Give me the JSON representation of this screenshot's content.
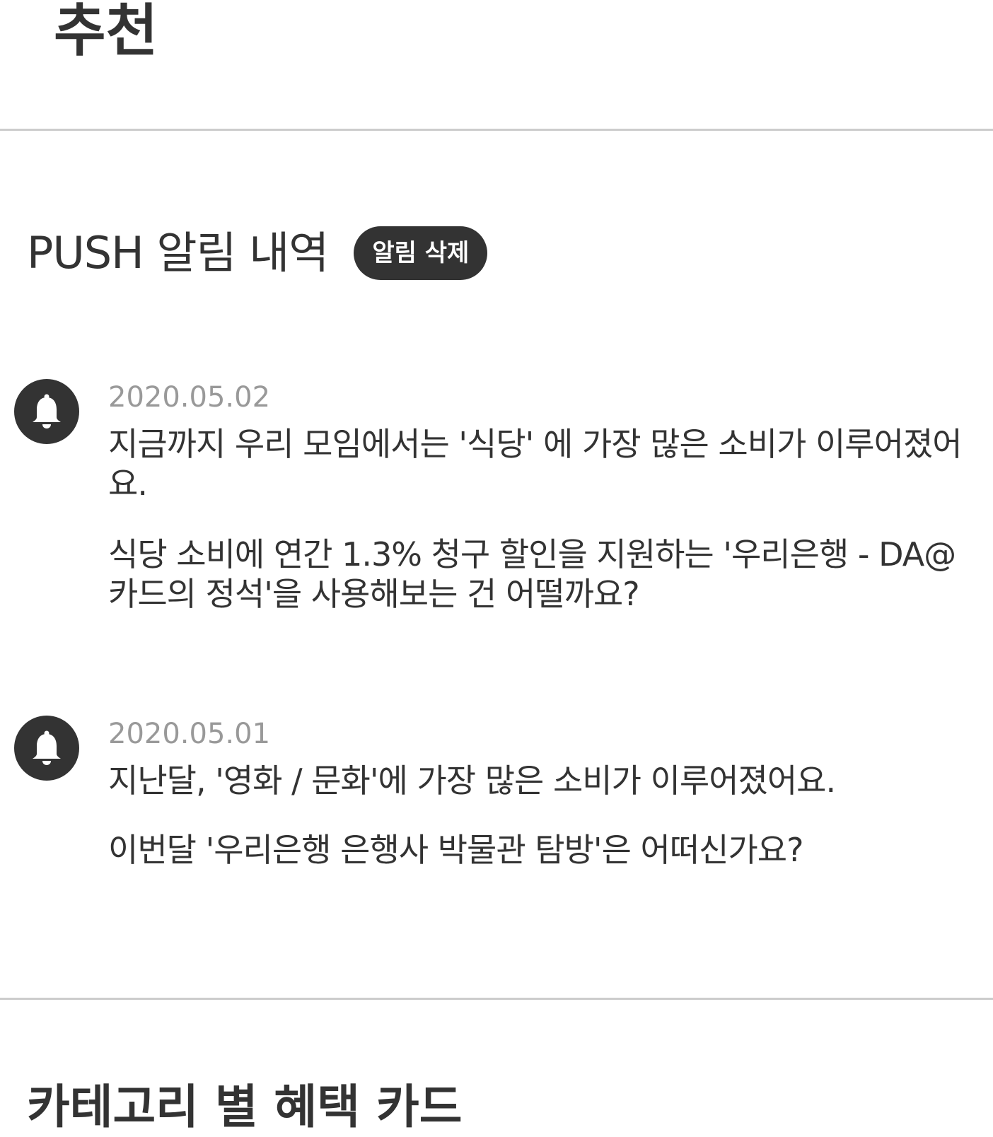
{
  "header": {
    "title": "추천"
  },
  "push": {
    "title": "PUSH 알림 내역",
    "delete_label": "알림 삭제",
    "notifications": [
      {
        "icon": "bell-icon",
        "date": "2020.05.02",
        "paragraphs": [
          "지금까지 우리 모임에서는 '식당' 에 가장 많은 소비가 이루어졌어요.",
          "식당 소비에 연간 1.3% 청구 할인을 지원하는 '우리은행 - DA@카드의 정석'을 사용해보는 건 어떨까요?"
        ]
      },
      {
        "icon": "bell-icon",
        "date": "2020.05.01",
        "paragraphs": [
          "지난달, '영화 / 문화'에 가장 많은 소비가 이루어졌어요.",
          "이번달 '우리은행 은행사 박물관 탐방'은 어떠신가요?"
        ]
      }
    ]
  },
  "category": {
    "title": "카테고리 별 혜택 카드"
  },
  "colors": {
    "text": "#333333",
    "date": "#999999",
    "divider": "#cccccc",
    "button_bg": "#333333",
    "button_text": "#ffffff"
  }
}
